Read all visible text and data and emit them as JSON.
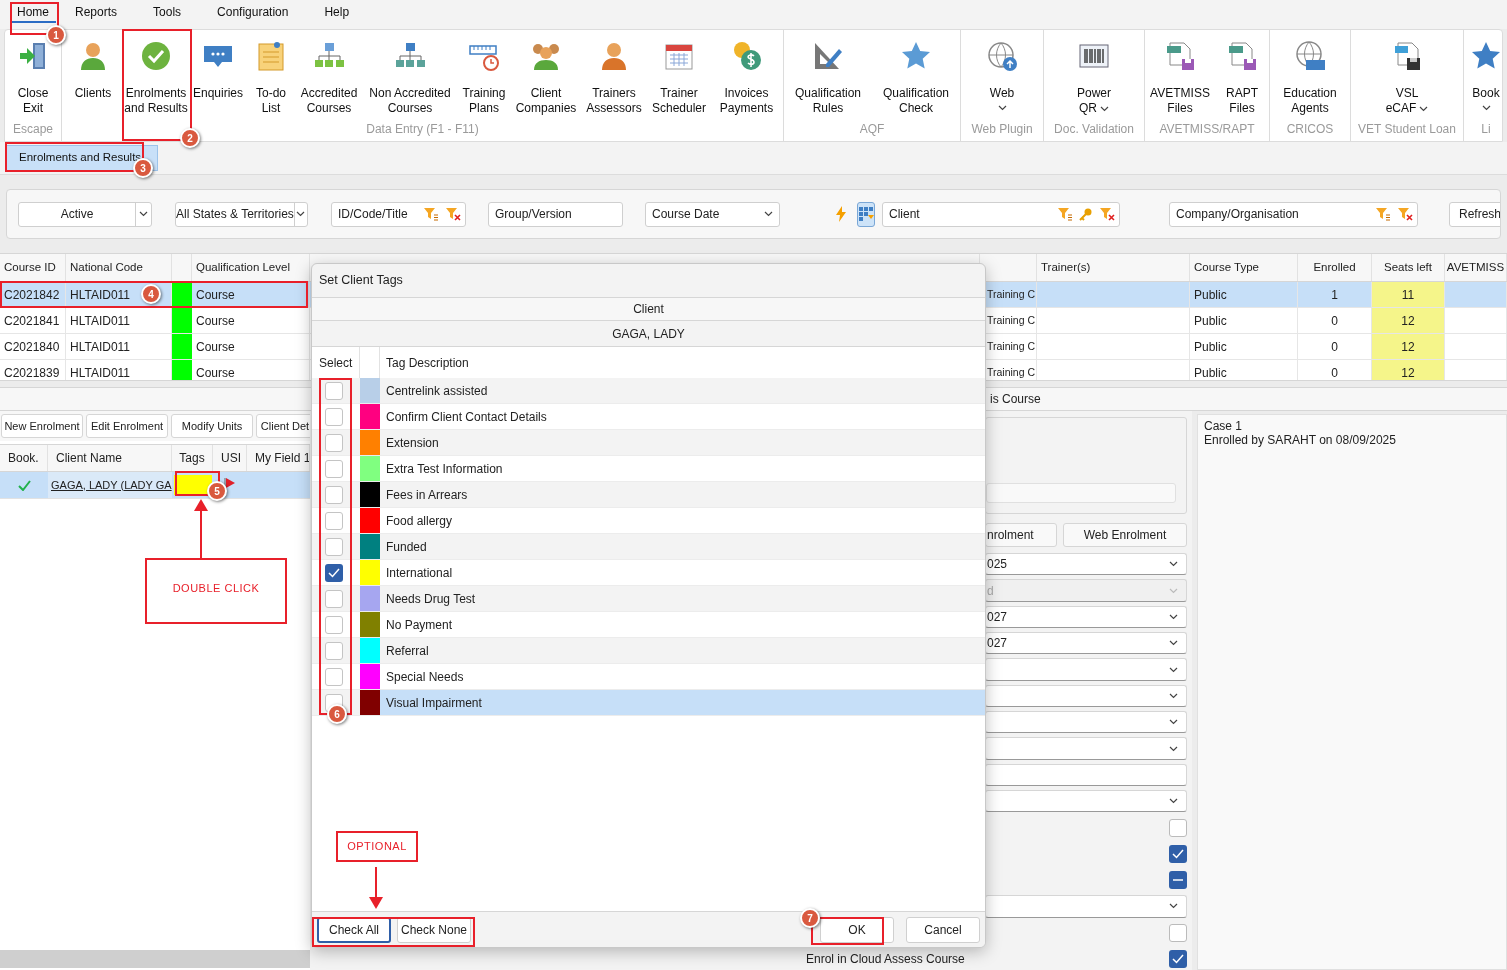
{
  "menu": [
    {
      "label": "Home",
      "selected": true
    },
    {
      "label": "Reports",
      "selected": false
    },
    {
      "label": "Tools",
      "selected": false
    },
    {
      "label": "Configuration",
      "selected": false
    },
    {
      "label": "Help",
      "selected": false
    }
  ],
  "ribbon": [
    {
      "label": "Escape",
      "items": [
        {
          "lines": [
            "Close",
            "Exit"
          ]
        }
      ]
    },
    {
      "label": "Data Entry (F1 - F11)",
      "items": [
        {
          "lines": [
            "Clients"
          ]
        },
        {
          "lines": [
            "Enrolments",
            "and Results"
          ]
        },
        {
          "lines": [
            "Enquiries"
          ]
        },
        {
          "lines": [
            "To-do",
            "List"
          ]
        },
        {
          "lines": [
            "Accredited",
            "Courses"
          ]
        },
        {
          "lines": [
            "Non Accredited",
            "Courses"
          ]
        },
        {
          "lines": [
            "Training",
            "Plans"
          ]
        },
        {
          "lines": [
            "Client",
            "Companies"
          ]
        },
        {
          "lines": [
            "Trainers",
            "Assessors"
          ]
        },
        {
          "lines": [
            "Trainer",
            "Scheduler"
          ]
        },
        {
          "lines": [
            "Invoices",
            "Payments"
          ]
        }
      ]
    },
    {
      "label": "AQF",
      "items": [
        {
          "lines": [
            "Qualification",
            "Rules"
          ]
        },
        {
          "lines": [
            "Qualification",
            "Check"
          ]
        }
      ]
    },
    {
      "label": "Web Plugin",
      "items": [
        {
          "lines": [
            "Web"
          ],
          "dropdown": true
        }
      ]
    },
    {
      "label": "Doc. Validation",
      "items": [
        {
          "lines": [
            "Power",
            "QR"
          ],
          "dropdown": true
        }
      ]
    },
    {
      "label": "AVETMISS/RAPT",
      "items": [
        {
          "lines": [
            "AVETMISS",
            "Files"
          ]
        },
        {
          "lines": [
            "RAPT",
            "Files"
          ]
        }
      ]
    },
    {
      "label": "CRICOS",
      "items": [
        {
          "lines": [
            "Education",
            "Agents"
          ]
        }
      ]
    },
    {
      "label": "VET Student Loan",
      "items": [
        {
          "lines": [
            "VSL",
            "eCAF"
          ],
          "dropdown": true
        }
      ]
    },
    {
      "label": "Li",
      "items": [
        {
          "lines": [
            "Book"
          ],
          "dropdown": true
        }
      ]
    }
  ],
  "document_tabs": [
    {
      "label": "Enrolments and Results",
      "selected": true
    }
  ],
  "filters": [
    {
      "kind": "dropdown",
      "value": "Active"
    },
    {
      "kind": "dropdown",
      "value": "All States & Territories"
    },
    {
      "kind": "search",
      "value": "ID/Code/Title"
    },
    {
      "kind": "field",
      "value": "Group/Version"
    },
    {
      "kind": "select",
      "value": "Course Date"
    },
    {
      "kind": "quick"
    },
    {
      "kind": "toggle",
      "selected": true
    },
    {
      "kind": "search",
      "value": "Client",
      "key": true
    },
    {
      "kind": "search",
      "value": "Company/Organisation"
    },
    {
      "kind": "button",
      "value": "Refresh"
    }
  ],
  "courses": {
    "columns": {
      "course_id": "Course ID",
      "national_code": "National Code",
      "qualification_level": "Qualification Level",
      "trainers": "Trainer(s)",
      "course_type": "Course Type",
      "enrolled": "Enrolled",
      "seats_left": "Seats left",
      "avetmiss": "AVETMISS"
    },
    "rows": [
      {
        "selected": true,
        "color": "#00ff00",
        "course_id": "C2021842",
        "national_code": "HLTAID011",
        "qualification_level": "Course",
        "column_5": "Training C",
        "course_type": "Public",
        "enrolled": "1",
        "seats_left": "11"
      },
      {
        "selected": false,
        "color": "#00ff00",
        "course_id": "C2021841",
        "national_code": "HLTAID011",
        "qualification_level": "Course",
        "column_5": "Training C",
        "course_type": "Public",
        "enrolled": "0",
        "seats_left": "12"
      },
      {
        "selected": false,
        "color": "#00ff00",
        "course_id": "C2021840",
        "national_code": "HLTAID011",
        "qualification_level": "Course",
        "column_5": "Training C",
        "course_type": "Public",
        "enrolled": "0",
        "seats_left": "12"
      },
      {
        "selected": false,
        "color": "#00ff00",
        "course_id": "C2021839",
        "national_code": "HLTAID011",
        "qualification_level": "Course",
        "column_5": "Training C",
        "course_type": "Public",
        "enrolled": "0",
        "seats_left": "12"
      }
    ]
  },
  "section_label": "is Course",
  "enrolments": {
    "buttons": [
      "New Enrolment",
      "Edit Enrolment",
      "Modify Units",
      "Client Det"
    ],
    "columns": {
      "book": "Book.",
      "client_name": "Client Name",
      "tags": "Tags",
      "usi": "USI",
      "my_field": "My Field 1"
    },
    "rows": [
      {
        "selected": true,
        "booked": true,
        "client_name": "GAGA, LADY (LADY GA",
        "color": "#ffff00",
        "usi_flag": true
      }
    ]
  },
  "form": [
    {
      "kind": "panel"
    },
    {
      "kind": "buttons",
      "labels": [
        "nrolment",
        "Web Enrolment"
      ]
    },
    {
      "kind": "dropdown",
      "value": "025",
      "disabled": false
    },
    {
      "kind": "dropdown",
      "value": "d",
      "disabled": true
    },
    {
      "kind": "dropdown",
      "value": "027",
      "disabled": false
    },
    {
      "kind": "dropdown",
      "value": "027",
      "disabled": false
    },
    {
      "kind": "dropdown",
      "disabled": false
    },
    {
      "kind": "dropdown",
      "disabled": false
    },
    {
      "kind": "dropdown",
      "disabled": false
    },
    {
      "kind": "dropdown",
      "disabled": false
    },
    {
      "kind": "field"
    },
    {
      "kind": "dropdown",
      "disabled": false
    },
    {
      "kind": "checkbox",
      "checked": false
    },
    {
      "kind": "checkbox",
      "checked": true
    },
    {
      "kind": "checkbox",
      "mixed": true
    },
    {
      "kind": "dropdown",
      "disabled": false
    },
    {
      "kind": "checkbox",
      "checked": false
    },
    {
      "kind": "checkbox",
      "checked": true,
      "label": "Enrol in Cloud Assess Course"
    }
  ],
  "notes": [
    "Case 1",
    "Enrolled by SARAHT on 08/09/2025"
  ],
  "dialog": {
    "title": "Set Client Tags",
    "client_label": "Client",
    "client_name": "GAGA, LADY",
    "columns": {
      "select": "Select",
      "description": "Tag Description"
    },
    "tags": [
      {
        "label": "Centrelink assisted",
        "color": "#b8cfe8",
        "checked": false,
        "selected": false
      },
      {
        "label": "Confirm Client Contact Details",
        "color": "#ff0080",
        "checked": false,
        "selected": false
      },
      {
        "label": "Extension",
        "color": "#ff8000",
        "checked": false,
        "selected": false
      },
      {
        "label": "Extra Test Information",
        "color": "#80ff80",
        "checked": false,
        "selected": false
      },
      {
        "label": "Fees in Arrears",
        "color": "#000000",
        "checked": false,
        "selected": false
      },
      {
        "label": "Food allergy",
        "color": "#ff0000",
        "checked": false,
        "selected": false
      },
      {
        "label": "Funded",
        "color": "#008080",
        "checked": false,
        "selected": false
      },
      {
        "label": "International",
        "color": "#ffff00",
        "checked": true,
        "selected": false
      },
      {
        "label": "Needs Drug Test",
        "color": "#a6a6f0",
        "checked": false,
        "selected": false
      },
      {
        "label": "No Payment",
        "color": "#808000",
        "checked": false,
        "selected": false
      },
      {
        "label": "Referral",
        "color": "#00ffff",
        "checked": false,
        "selected": false
      },
      {
        "label": "Special Needs",
        "color": "#ff00ff",
        "checked": false,
        "selected": false
      },
      {
        "label": "Visual Impairment",
        "color": "#800000",
        "checked": false,
        "selected": true
      }
    ],
    "buttons": [
      {
        "label": "Check All",
        "focused": true
      },
      {
        "label": "Check None",
        "focused": false
      },
      {
        "label": "OK",
        "focused": false
      },
      {
        "label": "Cancel",
        "focused": false
      }
    ]
  },
  "annotations": {
    "markers": [
      "1",
      "2",
      "3",
      "4",
      "5",
      "6",
      "7"
    ],
    "callouts": [
      "DOUBLE CLICK",
      "OPTIONAL"
    ]
  }
}
